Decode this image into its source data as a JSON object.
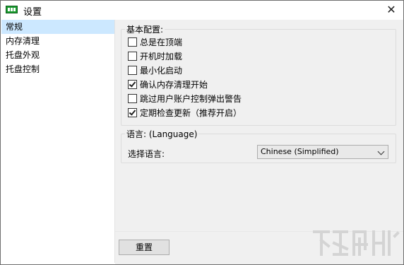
{
  "window": {
    "title": "设置",
    "close_glyph": "✕"
  },
  "sidebar": {
    "items": [
      {
        "label": "常规",
        "selected": true
      },
      {
        "label": "内存清理",
        "selected": false
      },
      {
        "label": "托盘外观",
        "selected": false
      },
      {
        "label": "托盘控制",
        "selected": false
      }
    ]
  },
  "basic": {
    "title": "基本配置:",
    "options": [
      {
        "label": "总是在顶端",
        "checked": false
      },
      {
        "label": "开机时加载",
        "checked": false
      },
      {
        "label": "最小化启动",
        "checked": false
      },
      {
        "label": "确认内存清理开始",
        "checked": true
      },
      {
        "label": "跳过用户账户控制弹出警告",
        "checked": false
      },
      {
        "label": "定期检查更新（推荐开启）",
        "checked": true
      }
    ]
  },
  "language": {
    "title": "语言: (Language)",
    "label": "选择语言:",
    "selected": "Chinese (Simplified)"
  },
  "footer": {
    "reset_label": "重置"
  },
  "colors": {
    "selection": "#cce8ff",
    "panel": "#f0f0f0",
    "icon_green": "#1a9b2f"
  },
  "icons": {
    "app": "app-icon",
    "close": "close-icon",
    "dropdown": "chevron-down-icon"
  }
}
